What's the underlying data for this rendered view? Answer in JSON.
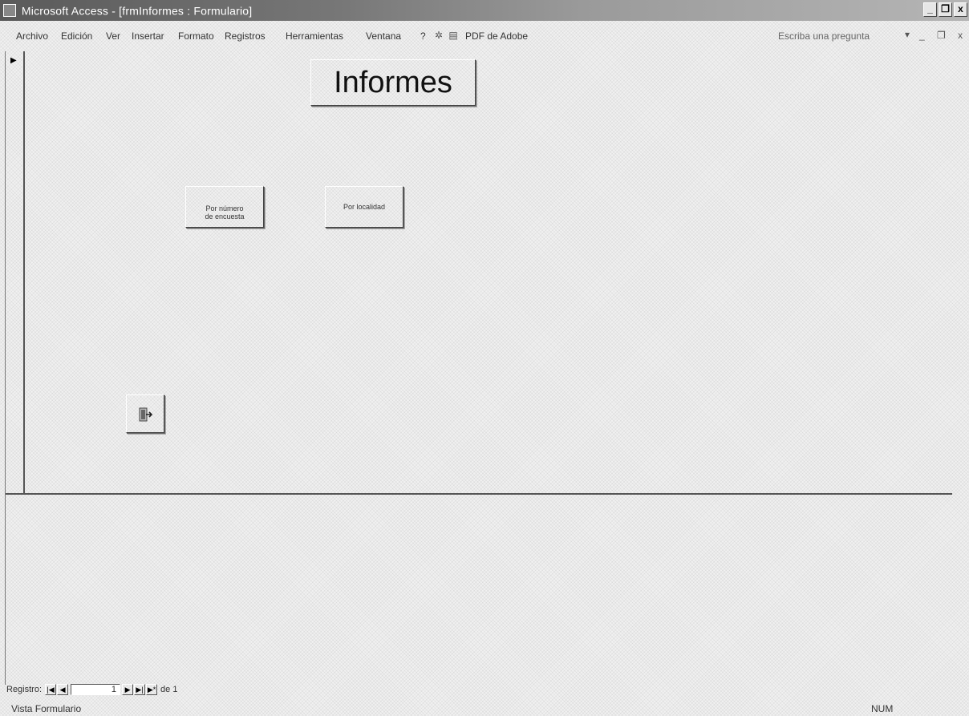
{
  "window": {
    "title": "Microsoft Access - [frmInformes : Formulario]",
    "min": "_",
    "restore": "❐",
    "close": "x"
  },
  "menu": {
    "items": [
      "Archivo",
      "Edición",
      "Ver",
      "Insertar",
      "Formato",
      "Registros",
      "Herramientas",
      "Ventana",
      "?"
    ],
    "pdf": "PDF de Adobe",
    "ask_placeholder": "Escriba una pregunta",
    "ask_dropdown": "▾",
    "doc_controls": "_ ❐ x"
  },
  "form": {
    "title": "Informes",
    "record_selector": "▶",
    "buttons": {
      "por_numero_line1": "Por número",
      "por_numero_line2": "de encuesta",
      "por_localidad": "Por localidad",
      "exit_icon": "exit-door-icon"
    }
  },
  "navigation": {
    "label": "Registro:",
    "first": "|◀",
    "prev": "◀",
    "current": "1",
    "next": "▶",
    "last": "▶|",
    "new": "▶*",
    "total": "de 1"
  },
  "status": {
    "view": "Vista Formulario",
    "num": "NUM"
  }
}
